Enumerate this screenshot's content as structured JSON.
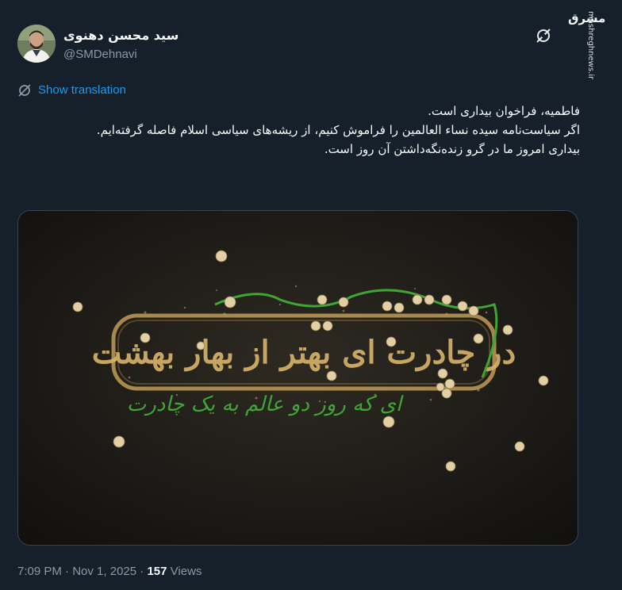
{
  "author": {
    "display_name": "سید محسن دهنوی",
    "handle": "@SMDehnavi"
  },
  "watermark": {
    "logo_text": "مشرق",
    "url": "mashreghnews.ir"
  },
  "translate": {
    "label": "Show translation",
    "icon": "globe-icon"
  },
  "tweet": {
    "lines": [
      "فاطمیه، فراخوان بیداری است.",
      "اگر سیاست‌نامه سیده نساء العالمین را فراموش کنیم، از ریشه‌های سیاسی اسلام فاصله گرفته‌ایم.",
      "بیداری امروز ما در گرو زنده‌نگه‌داشتن آن روز است."
    ]
  },
  "media": {
    "calligraphy_main": "در چادرت ای بهتر از بهار بهشت",
    "calligraphy_green": "ای که روز دو عالم به یک چادرت"
  },
  "meta": {
    "time": "7:09 PM",
    "separator": "·",
    "date": "Nov 1, 2025",
    "views_count": "157",
    "views_label": "Views"
  },
  "colors": {
    "background": "#15202b",
    "link": "#1d9bf0",
    "secondary_text": "#8b98a5",
    "calligraphy_green": "#3fa535",
    "sand": "#c9a35a"
  }
}
